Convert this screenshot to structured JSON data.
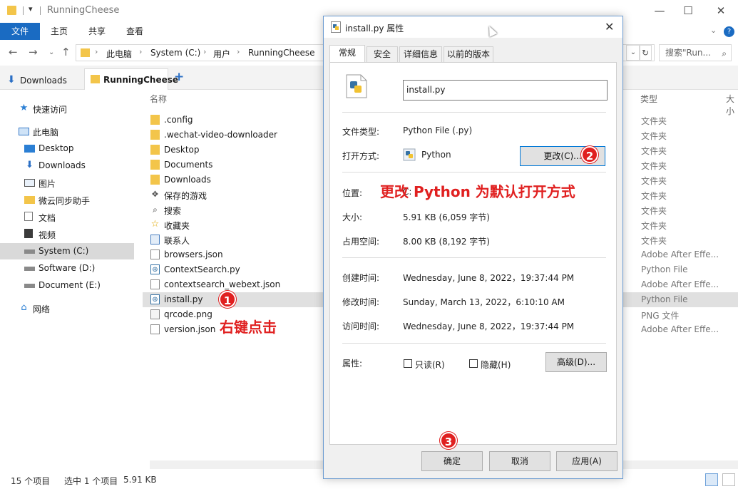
{
  "window": {
    "title": "RunningCheese",
    "dropdown": "▾",
    "minimize": "—",
    "maximize": "☐",
    "close": "✕"
  },
  "ribbon": {
    "file": "文件",
    "tabs": [
      "主页",
      "共享",
      "查看"
    ],
    "help": "?",
    "chevron": "⌄"
  },
  "address": {
    "crumbs": [
      "此电脑",
      "System (C:)",
      "用户",
      "RunningCheese"
    ],
    "search_placeholder": "搜索\"Run..."
  },
  "tabs": {
    "downloads": "Downloads",
    "current": "RunningCheese",
    "add": "+"
  },
  "nav": {
    "items": [
      {
        "label": "快速访问",
        "icon": "star-icon"
      },
      {
        "label": "此电脑",
        "icon": "computer-icon"
      },
      {
        "label": "Desktop",
        "icon": "desktop-icon"
      },
      {
        "label": "Downloads",
        "icon": "download-icon"
      },
      {
        "label": "图片",
        "icon": "pictures-icon"
      },
      {
        "label": "微云同步助手",
        "icon": "cloud-icon"
      },
      {
        "label": "文档",
        "icon": "documents-icon"
      },
      {
        "label": "视频",
        "icon": "video-icon"
      },
      {
        "label": "System (C:)",
        "icon": "drive-icon"
      },
      {
        "label": "Software (D:)",
        "icon": "drive-icon"
      },
      {
        "label": "Document (E:)",
        "icon": "drive-icon"
      },
      {
        "label": "网络",
        "icon": "network-icon"
      }
    ]
  },
  "filelist": {
    "col_name": "名称",
    "col_type": "类型",
    "col_size": "大小",
    "files": [
      {
        "name": ".config",
        "type": "文件夹",
        "icon": "folder-icon"
      },
      {
        "name": ".wechat-video-downloader",
        "type": "文件夹",
        "icon": "folder-icon"
      },
      {
        "name": "Desktop",
        "type": "文件夹",
        "icon": "folder-icon"
      },
      {
        "name": "Documents",
        "type": "文件夹",
        "icon": "folder-icon"
      },
      {
        "name": "Downloads",
        "type": "文件夹",
        "icon": "folder-icon"
      },
      {
        "name": "保存的游戏",
        "type": "文件夹",
        "icon": "games-icon"
      },
      {
        "name": "搜索",
        "type": "文件夹",
        "icon": "search-icon"
      },
      {
        "name": "收藏夹",
        "type": "文件夹",
        "icon": "favorites-icon"
      },
      {
        "name": "联系人",
        "type": "文件夹",
        "icon": "contacts-icon"
      },
      {
        "name": "browsers.json",
        "type": "Adobe After Effe...",
        "icon": "json-file-icon"
      },
      {
        "name": "ContextSearch.py",
        "type": "Python File",
        "icon": "python-file-icon"
      },
      {
        "name": "contextsearch_webext.json",
        "type": "Adobe After Effe...",
        "icon": "json-file-icon"
      },
      {
        "name": "install.py",
        "type": "Python File",
        "icon": "python-file-icon"
      },
      {
        "name": "qrcode.png",
        "type": "PNG 文件",
        "icon": "image-file-icon"
      },
      {
        "name": "version.json",
        "type": "Adobe After Effe...",
        "icon": "json-file-icon"
      }
    ]
  },
  "status": {
    "count": "15 个项目",
    "selected": "选中 1 个项目",
    "size": "5.91 KB"
  },
  "dialog": {
    "title": "install.py 属性",
    "close": "✕",
    "tabs": [
      "常规",
      "安全",
      "详细信息",
      "以前的版本"
    ],
    "filename": "install.py",
    "file_type_label": "文件类型:",
    "file_type": "Python File (.py)",
    "open_with_label": "打开方式:",
    "open_with": "Python",
    "change_button": "更改(C)...",
    "location_label": "位置:",
    "location_value": "C:",
    "size_label": "大小:",
    "size": "5.91 KB (6,059 字节)",
    "disk_label": "占用空间:",
    "disk": "8.00 KB (8,192 字节)",
    "created_label": "创建时间:",
    "created": "Wednesday, June 8, 2022，19:37:44 PM",
    "modified_label": "修改时间:",
    "modified": "Sunday, March 13, 2022，6:10:10 AM",
    "accessed_label": "访问时间:",
    "accessed": "Wednesday, June 8, 2022，19:37:44 PM",
    "attr_label": "属性:",
    "readonly": "只读(R)",
    "hidden": "隐藏(H)",
    "advanced": "高级(D)...",
    "ok": "确定",
    "cancel": "取消",
    "apply": "应用(A)"
  },
  "annotations": {
    "step1": "1",
    "step1_text": "右键点击",
    "step2": "2",
    "step2_text": "更改 Python 为默认打开方式",
    "step3": "3"
  },
  "colors": {
    "accent": "#1a6bc2",
    "annotation": "#e02020",
    "folder": "#f3c54a"
  }
}
